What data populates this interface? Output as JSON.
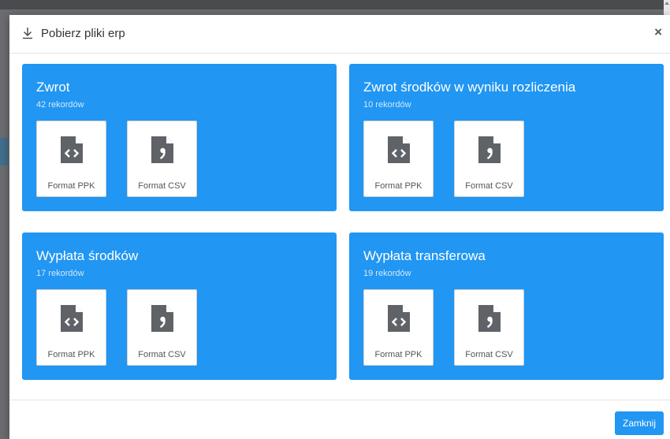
{
  "modal": {
    "title": "Pobierz pliki erp",
    "close_symbol": "×",
    "footer_button": "Zamknij"
  },
  "accent_color": "#2196f3",
  "cards": [
    {
      "title": "Zwrot",
      "count": "42 rekordów",
      "buttons": [
        {
          "label": "Format PPK",
          "icon": "file-code-icon"
        },
        {
          "label": "Format CSV",
          "icon": "file-csv-icon"
        }
      ]
    },
    {
      "title": "Zwrot środków w wyniku rozliczenia",
      "count": "10 rekordów",
      "buttons": [
        {
          "label": "Format PPK",
          "icon": "file-code-icon"
        },
        {
          "label": "Format CSV",
          "icon": "file-csv-icon"
        }
      ]
    },
    {
      "title": "Wypłata środków",
      "count": "17 rekordów",
      "buttons": [
        {
          "label": "Format PPK",
          "icon": "file-code-icon"
        },
        {
          "label": "Format CSV",
          "icon": "file-csv-icon"
        }
      ]
    },
    {
      "title": "Wypłata transferowa",
      "count": "19 rekordów",
      "buttons": [
        {
          "label": "Format PPK",
          "icon": "file-code-icon"
        },
        {
          "label": "Format CSV",
          "icon": "file-csv-icon"
        }
      ]
    }
  ]
}
